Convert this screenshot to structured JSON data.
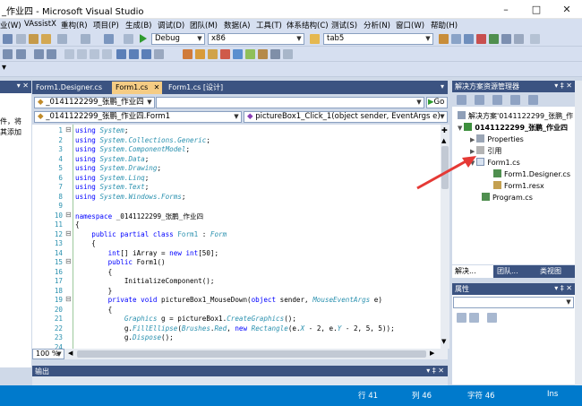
{
  "window": {
    "title": "_作业四 - Microsoft Visual Studio"
  },
  "menu": [
    "业(W)",
    "VAssistX",
    "重构(R)",
    "项目(P)",
    "生成(B)",
    "调试(D)",
    "团队(M)",
    "数据(A)",
    "工具(T)",
    "体系结构(C)",
    "测试(S)",
    "分析(N)",
    "窗口(W)",
    "帮助(H)"
  ],
  "toolbar": {
    "config": "Debug",
    "platform": "x86",
    "find_text": "tab5"
  },
  "tabs": [
    "Form1.Designer.cs",
    "Form1.cs",
    "Form1.cs [设计]"
  ],
  "nav": {
    "class_combo": "_0141122299_张鹏_作业四",
    "type_combo": "_0141122299_张鹏_作业四.Form1",
    "member_combo": "pictureBox1_Click_1(object sender, EventArgs e)",
    "go": "Go"
  },
  "left_panel": {
    "line1": "件，将",
    "line2": "其添加"
  },
  "zoom": "100 %",
  "output": {
    "title": "输出"
  },
  "solution_explorer": {
    "title": "解决方案资源管理器",
    "solution": "解决方案'0141122299_张鹏_作",
    "project": "0141122299_张鹏_作业四",
    "properties": "Properties",
    "references": "引用",
    "form": "Form1.cs",
    "designer": "Form1.Designer.cs",
    "resx": "Form1.resx",
    "program": "Program.cs",
    "tab1": "解决...",
    "tab2": "团队...",
    "tab3": "类视图"
  },
  "properties": {
    "title": "属性"
  },
  "status": {
    "row": "行 41",
    "col": "列 46",
    "char": "字符 46",
    "ins": "Ins"
  },
  "colors": {
    "accent": "#3b5381",
    "active_tab": "#f5cc84",
    "status": "#007acc",
    "arrow": "#e53935"
  }
}
